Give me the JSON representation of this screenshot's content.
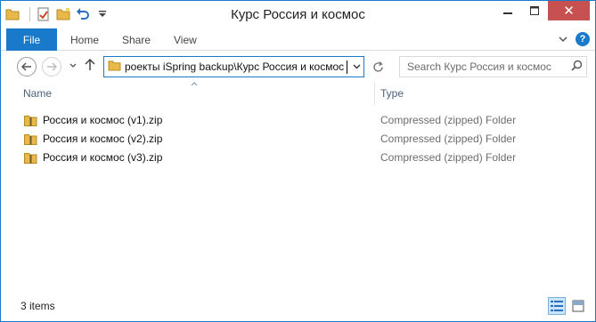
{
  "window": {
    "title": "Курс Россия и космос",
    "quick_access": [
      "folder-icon",
      "properties-icon",
      "new-folder-icon",
      "undo-icon",
      "customize-dropdown-icon"
    ]
  },
  "ribbon": {
    "file_label": "File",
    "tabs": [
      {
        "label": "Home"
      },
      {
        "label": "Share"
      },
      {
        "label": "View"
      }
    ]
  },
  "nav": {
    "address_path": "роекты iSpring backup\\Курс Россия и космос",
    "search_placeholder": "Search Курс Россия и космос"
  },
  "columns": {
    "name": "Name",
    "type": "Type"
  },
  "files": [
    {
      "name": "Россия и космос (v1).zip",
      "type": "Compressed (zipped) Folder"
    },
    {
      "name": "Россия и космос (v2).zip",
      "type": "Compressed (zipped) Folder"
    },
    {
      "name": "Россия и космос (v3).zip",
      "type": "Compressed (zipped) Folder"
    }
  ],
  "status": {
    "items_text": "3 items"
  },
  "colors": {
    "accent": "#1979ca",
    "close_button": "#c75050",
    "folder_yellow": "#e8b84a",
    "header_text": "#4c607a",
    "type_text": "#6d6d6d"
  }
}
